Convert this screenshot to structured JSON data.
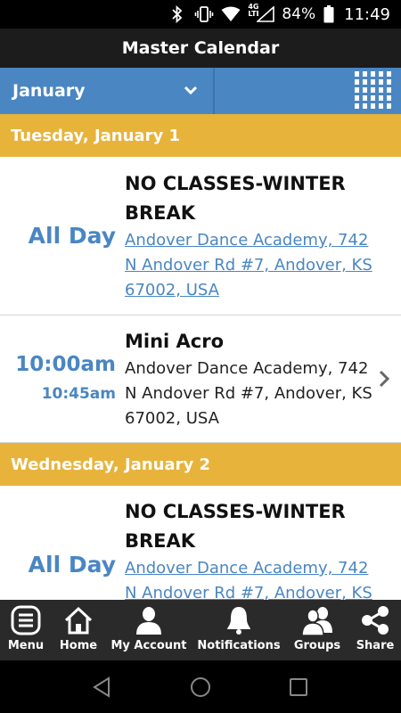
{
  "status_bar": {
    "network_type": "4G LTE",
    "battery": "84%",
    "time": "11:49",
    "icons": [
      "bluetooth-icon",
      "vibrate-icon",
      "wifi-icon",
      "signal-icon",
      "battery-icon"
    ]
  },
  "header": {
    "title": "Master Calendar"
  },
  "month_picker": {
    "selected": "January"
  },
  "days": [
    {
      "label": "Tuesday, January 1",
      "events": [
        {
          "all_day_label": "All Day",
          "title_line1": "NO CLASSES-WINTER",
          "title_line2": "BREAK",
          "location_line1": "Andover Dance Academy, 742",
          "location_line2": "N Andover Rd #7, Andover, KS",
          "location_line3": "67002, USA"
        },
        {
          "start": "10:00am",
          "end": "10:45am",
          "title": "Mini Acro",
          "location_line1": "Andover Dance Academy, 742",
          "location_line2": "N Andover Rd #7, Andover, KS",
          "location_line3": "67002, USA"
        }
      ]
    },
    {
      "label": "Wednesday, January 2",
      "events": [
        {
          "all_day_label": "All Day",
          "title_line1": "NO CLASSES-WINTER",
          "title_line2": "BREAK",
          "location_line1": "Andover Dance Academy, 742",
          "location_line2": "N Andover Rd #7, Andover, KS"
        }
      ]
    }
  ],
  "bottom_nav": [
    {
      "label": "Menu",
      "icon": "menu-icon"
    },
    {
      "label": "Home",
      "icon": "home-icon"
    },
    {
      "label": "My Account",
      "icon": "account-icon"
    },
    {
      "label": "Notifications",
      "icon": "bell-icon"
    },
    {
      "label": "Groups",
      "icon": "groups-icon"
    },
    {
      "label": "Share",
      "icon": "share-icon"
    }
  ],
  "colors": {
    "accent_blue": "#4a86c2",
    "day_header": "#e8b33a",
    "title_bar": "#1c1c1c",
    "bottom_nav": "#2a2a2a"
  }
}
